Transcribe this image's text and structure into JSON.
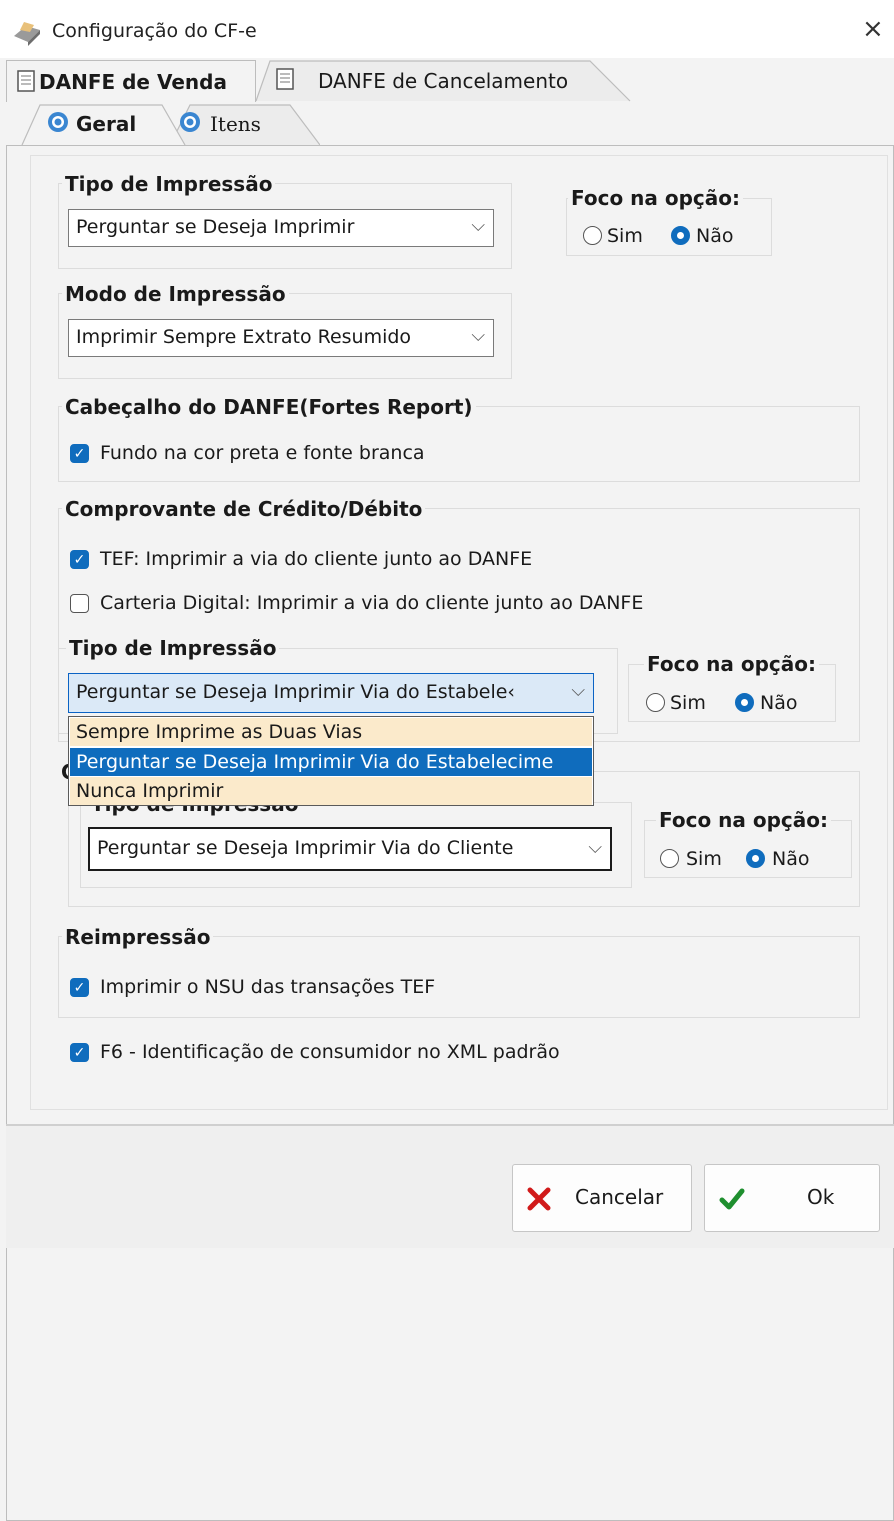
{
  "window": {
    "title": "Configuração do CF-e",
    "icon": "printer-icon",
    "close": "×"
  },
  "tabs": [
    {
      "label": "DANFE de Venda",
      "icon": "document-icon",
      "active": true
    },
    {
      "label": "DANFE de Cancelamento",
      "icon": "document-icon",
      "active": false
    }
  ],
  "subtabs": [
    {
      "label": "Geral",
      "icon": "gear-icon",
      "active": true
    },
    {
      "label": "Itens",
      "icon": "gear-icon",
      "active": false
    }
  ],
  "tipo_impressao": {
    "label": "Tipo de Impressão",
    "value": "Perguntar se Deseja Imprimir",
    "foco_label": "Foco na opção:",
    "sim": "Sim",
    "nao": "Não",
    "selected": "Não"
  },
  "modo_impressao": {
    "label": "Modo de Impressão",
    "value": "Imprimir Sempre Extrato Resumido"
  },
  "cabecalho": {
    "label": "Cabeçalho do DANFE(Fortes Report)",
    "checkbox_label": "Fundo na cor preta e fonte branca",
    "checked": true
  },
  "comprovante": {
    "label": "Comprovante de Crédito/Débito",
    "tef_label": "TEF: Imprimir a via do cliente junto ao DANFE",
    "tef_checked": true,
    "carteira_label": "Carteria Digital: Imprimir a via do cliente junto ao DANFE",
    "carteira_checked": false,
    "tipo_label": "Tipo de Impressão",
    "tipo_value": "Perguntar se Deseja Imprimir Via do Estabele‹",
    "foco_label": "Foco na opção:",
    "sim": "Sim",
    "nao": "Não",
    "selected": "Não",
    "dropdown_options": [
      "Sempre Imprime as Duas Vias",
      "Perguntar se Deseja Imprimir Via do Estabelecime",
      "Nunca Imprimir"
    ],
    "dropdown_selected": 1
  },
  "cliente": {
    "label": "C",
    "tipo_label": "Tipo de Impressão",
    "tipo_value": "Perguntar se Deseja Imprimir Via do Cliente",
    "foco_label": "Foco na opção:",
    "sim": "Sim",
    "nao": "Não",
    "selected": "Não"
  },
  "reimpressao": {
    "label": "Reimpressão",
    "checkbox_label": "Imprimir o NSU das transações TEF",
    "checked": true
  },
  "f6": {
    "checkbox_label": "F6 - Identificação de consumidor no XML padrão",
    "checked": true
  },
  "buttons": {
    "cancel": "Cancelar",
    "ok": "Ok"
  },
  "colors": {
    "accent": "#0f6cbd",
    "cancel_red": "#d11a1a",
    "ok_green": "#1f8f2f",
    "dropdown_bg": "#fbeacb"
  }
}
